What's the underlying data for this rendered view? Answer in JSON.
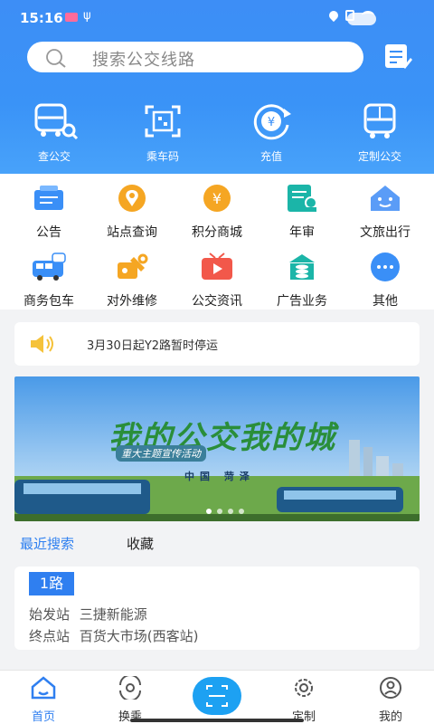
{
  "status": {
    "time": "15:16"
  },
  "search": {
    "placeholder": "搜索公交线路"
  },
  "quick_actions": [
    {
      "label": "查公交",
      "icon": "bus-search-icon"
    },
    {
      "label": "乘车码",
      "icon": "qr-code-icon"
    },
    {
      "label": "充值",
      "icon": "recharge-yen-icon"
    },
    {
      "label": "定制公交",
      "icon": "custom-bus-icon"
    }
  ],
  "services": [
    {
      "label": "公告",
      "icon": "announcement-icon"
    },
    {
      "label": "站点查询",
      "icon": "station-query-icon"
    },
    {
      "label": "积分商城",
      "icon": "points-mall-icon"
    },
    {
      "label": "年审",
      "icon": "annual-review-icon"
    },
    {
      "label": "文旅出行",
      "icon": "tourism-icon"
    },
    {
      "label": "商务包车",
      "icon": "charter-bus-icon"
    },
    {
      "label": "对外维修",
      "icon": "repair-icon"
    },
    {
      "label": "公交资讯",
      "icon": "bus-news-icon"
    },
    {
      "label": "广告业务",
      "icon": "advertising-icon"
    },
    {
      "label": "其他",
      "icon": "more-icon"
    }
  ],
  "notice": {
    "text": "3月30日起Y2路暂时停运"
  },
  "banner": {
    "title": "我的公交我的城",
    "subtitle": "重大主题宣传活动",
    "location": "中国 菏泽"
  },
  "tabs": {
    "recent": "最近搜索",
    "favorites": "收藏"
  },
  "route": {
    "name": "1路",
    "start_label": "始发站",
    "start": "三捷新能源",
    "end_label": "终点站",
    "end": "百货大市场(西客站)"
  },
  "nav": [
    {
      "label": "首页",
      "icon": "home-icon"
    },
    {
      "label": "换乘",
      "icon": "transfer-icon"
    },
    {
      "label": "定制",
      "icon": "custom-icon"
    },
    {
      "label": "我的",
      "icon": "profile-icon"
    }
  ],
  "colors": {
    "primary": "#3a8ff7",
    "accent": "#2f7ff0",
    "orange": "#f5a623",
    "teal": "#1bb5a8"
  }
}
